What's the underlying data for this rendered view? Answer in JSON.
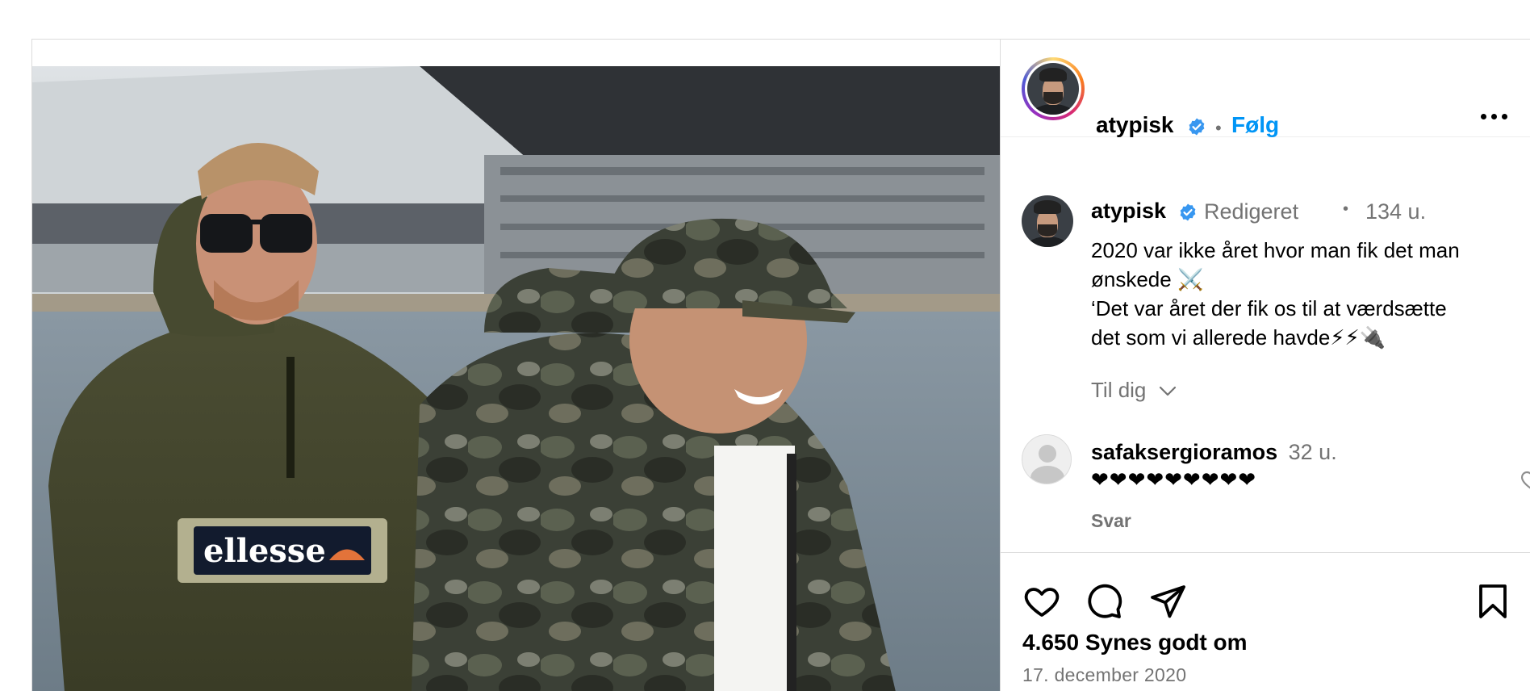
{
  "post": {
    "author": "atypisk",
    "follow_label": "Følg",
    "separator": "•",
    "more_icon": "more-horizontal-icon"
  },
  "caption": {
    "author": "atypisk",
    "edited_label": "Redigeret",
    "separator": "•",
    "time_ago": "134 u.",
    "lines": [
      "2020 var ikke året hvor man fik det man",
      "ønskede ⚔️",
      "‘Det var året der fik os til at værdsætte",
      "det som vi allerede havde⚡⚡🔌"
    ]
  },
  "comments_filter": {
    "label": "Til dig",
    "icon": "chevron-down-icon"
  },
  "comments": [
    {
      "username": "safaksergioramos",
      "time_ago": "32 u.",
      "text": "❤❤❤❤❤❤❤❤❤",
      "reply_label": "Svar"
    }
  ],
  "actions": {
    "like_icon": "heart-icon",
    "comment_icon": "comment-icon",
    "share_icon": "send-icon",
    "save_icon": "bookmark-icon"
  },
  "likes_text": "4.650 Synes godt om",
  "date_text": "17. december 2020",
  "colors": {
    "accent": "#0095f6",
    "verified": "#3897f0",
    "muted": "#737373",
    "border": "#dbdbdb"
  }
}
